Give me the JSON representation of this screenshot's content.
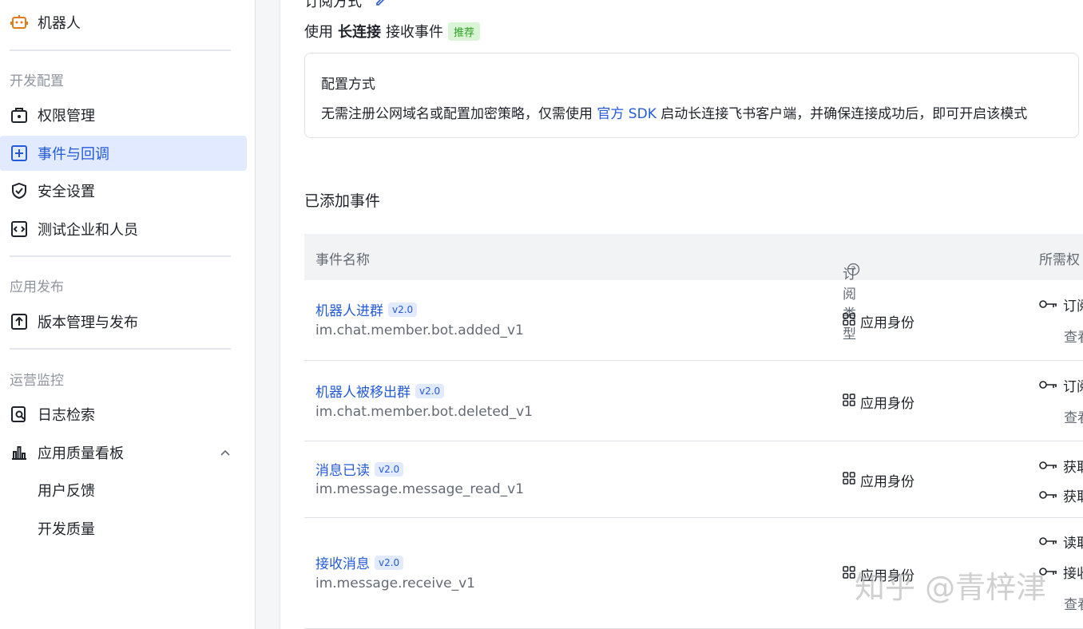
{
  "sidebar": {
    "bot_label": "机器人",
    "sections": {
      "dev": "开发配置",
      "release": "应用发布",
      "ops": "运营监控"
    },
    "items": {
      "permissions": "权限管理",
      "events": "事件与回调",
      "security": "安全设置",
      "test": "测试企业和人员",
      "versions": "版本管理与发布",
      "logs": "日志检索",
      "quality": "应用质量看板",
      "feedback": "用户反馈",
      "dev_quality": "开发质量"
    }
  },
  "main": {
    "subscribe_title": "订阅方式",
    "mode_prefix": "使用",
    "mode_bold": "长连接",
    "mode_suffix": "接收事件",
    "recommend_tag": "推荐",
    "config": {
      "title": "配置方式",
      "desc_pre": "无需注册公网域名或配置加密策略，仅需使用",
      "desc_link": "官方 SDK",
      "desc_post": "启动长连接飞书客户端，并确保连接成功后，即可开启该模式"
    },
    "events_title": "已添加事件",
    "table": {
      "col_name": "事件名称",
      "col_type": "订阅类型",
      "col_perm": "所需权"
    },
    "rows": [
      {
        "name": "机器人进群",
        "version": "v2.0",
        "key": "im.chat.member.bot.added_v1",
        "type": "应用身份",
        "perm1": "订阅",
        "perm2": "查看"
      },
      {
        "name": "机器人被移出群",
        "version": "v2.0",
        "key": "im.chat.member.bot.deleted_v1",
        "type": "应用身份",
        "perm1": "订阅",
        "perm2": "查看"
      },
      {
        "name": "消息已读",
        "version": "v2.0",
        "key": "im.message.message_read_v1",
        "type": "应用身份",
        "perm1": "获取",
        "perm2": "获取"
      },
      {
        "name": "接收消息",
        "version": "v2.0",
        "key": "im.message.receive_v1",
        "type": "应用身份",
        "perm1": "读取",
        "perm2": "接收",
        "perm3": "查看"
      }
    ]
  },
  "watermark": "知乎 @青梓津"
}
